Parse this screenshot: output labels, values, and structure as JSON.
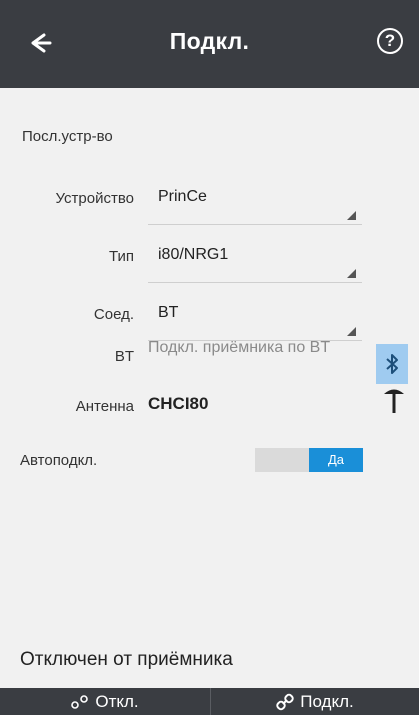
{
  "header": {
    "title": "Подкл.",
    "help_label": "?"
  },
  "section_label": "Посл.устр-во",
  "rows": {
    "device": {
      "label": "Устройство",
      "value": "PrinCe"
    },
    "type": {
      "label": "Тип",
      "value": "i80/NRG1"
    },
    "connection": {
      "label": "Соед.",
      "value": "BT"
    },
    "bt": {
      "label": "BT",
      "value": "Подкл. приёмника по BT"
    },
    "antenna": {
      "label": "Антенна",
      "value": "CHCI80"
    },
    "autoconnect": {
      "label": "Автоподкл.",
      "toggle_on_label": "Да"
    }
  },
  "status": "Отключен от приёмника",
  "buttons": {
    "disconnect": "Откл.",
    "connect": "Подкл."
  },
  "icons": {
    "back": "arrow-left-icon",
    "help": "help-circle-icon",
    "bluetooth": "bluetooth-icon",
    "antenna": "antenna-icon",
    "disconnect": "broken-link-icon",
    "connect": "link-icon"
  },
  "colors": {
    "header_bg": "#3a3d42",
    "accent": "#1a8fd8",
    "bt_button_bg": "#9fcbf0"
  }
}
